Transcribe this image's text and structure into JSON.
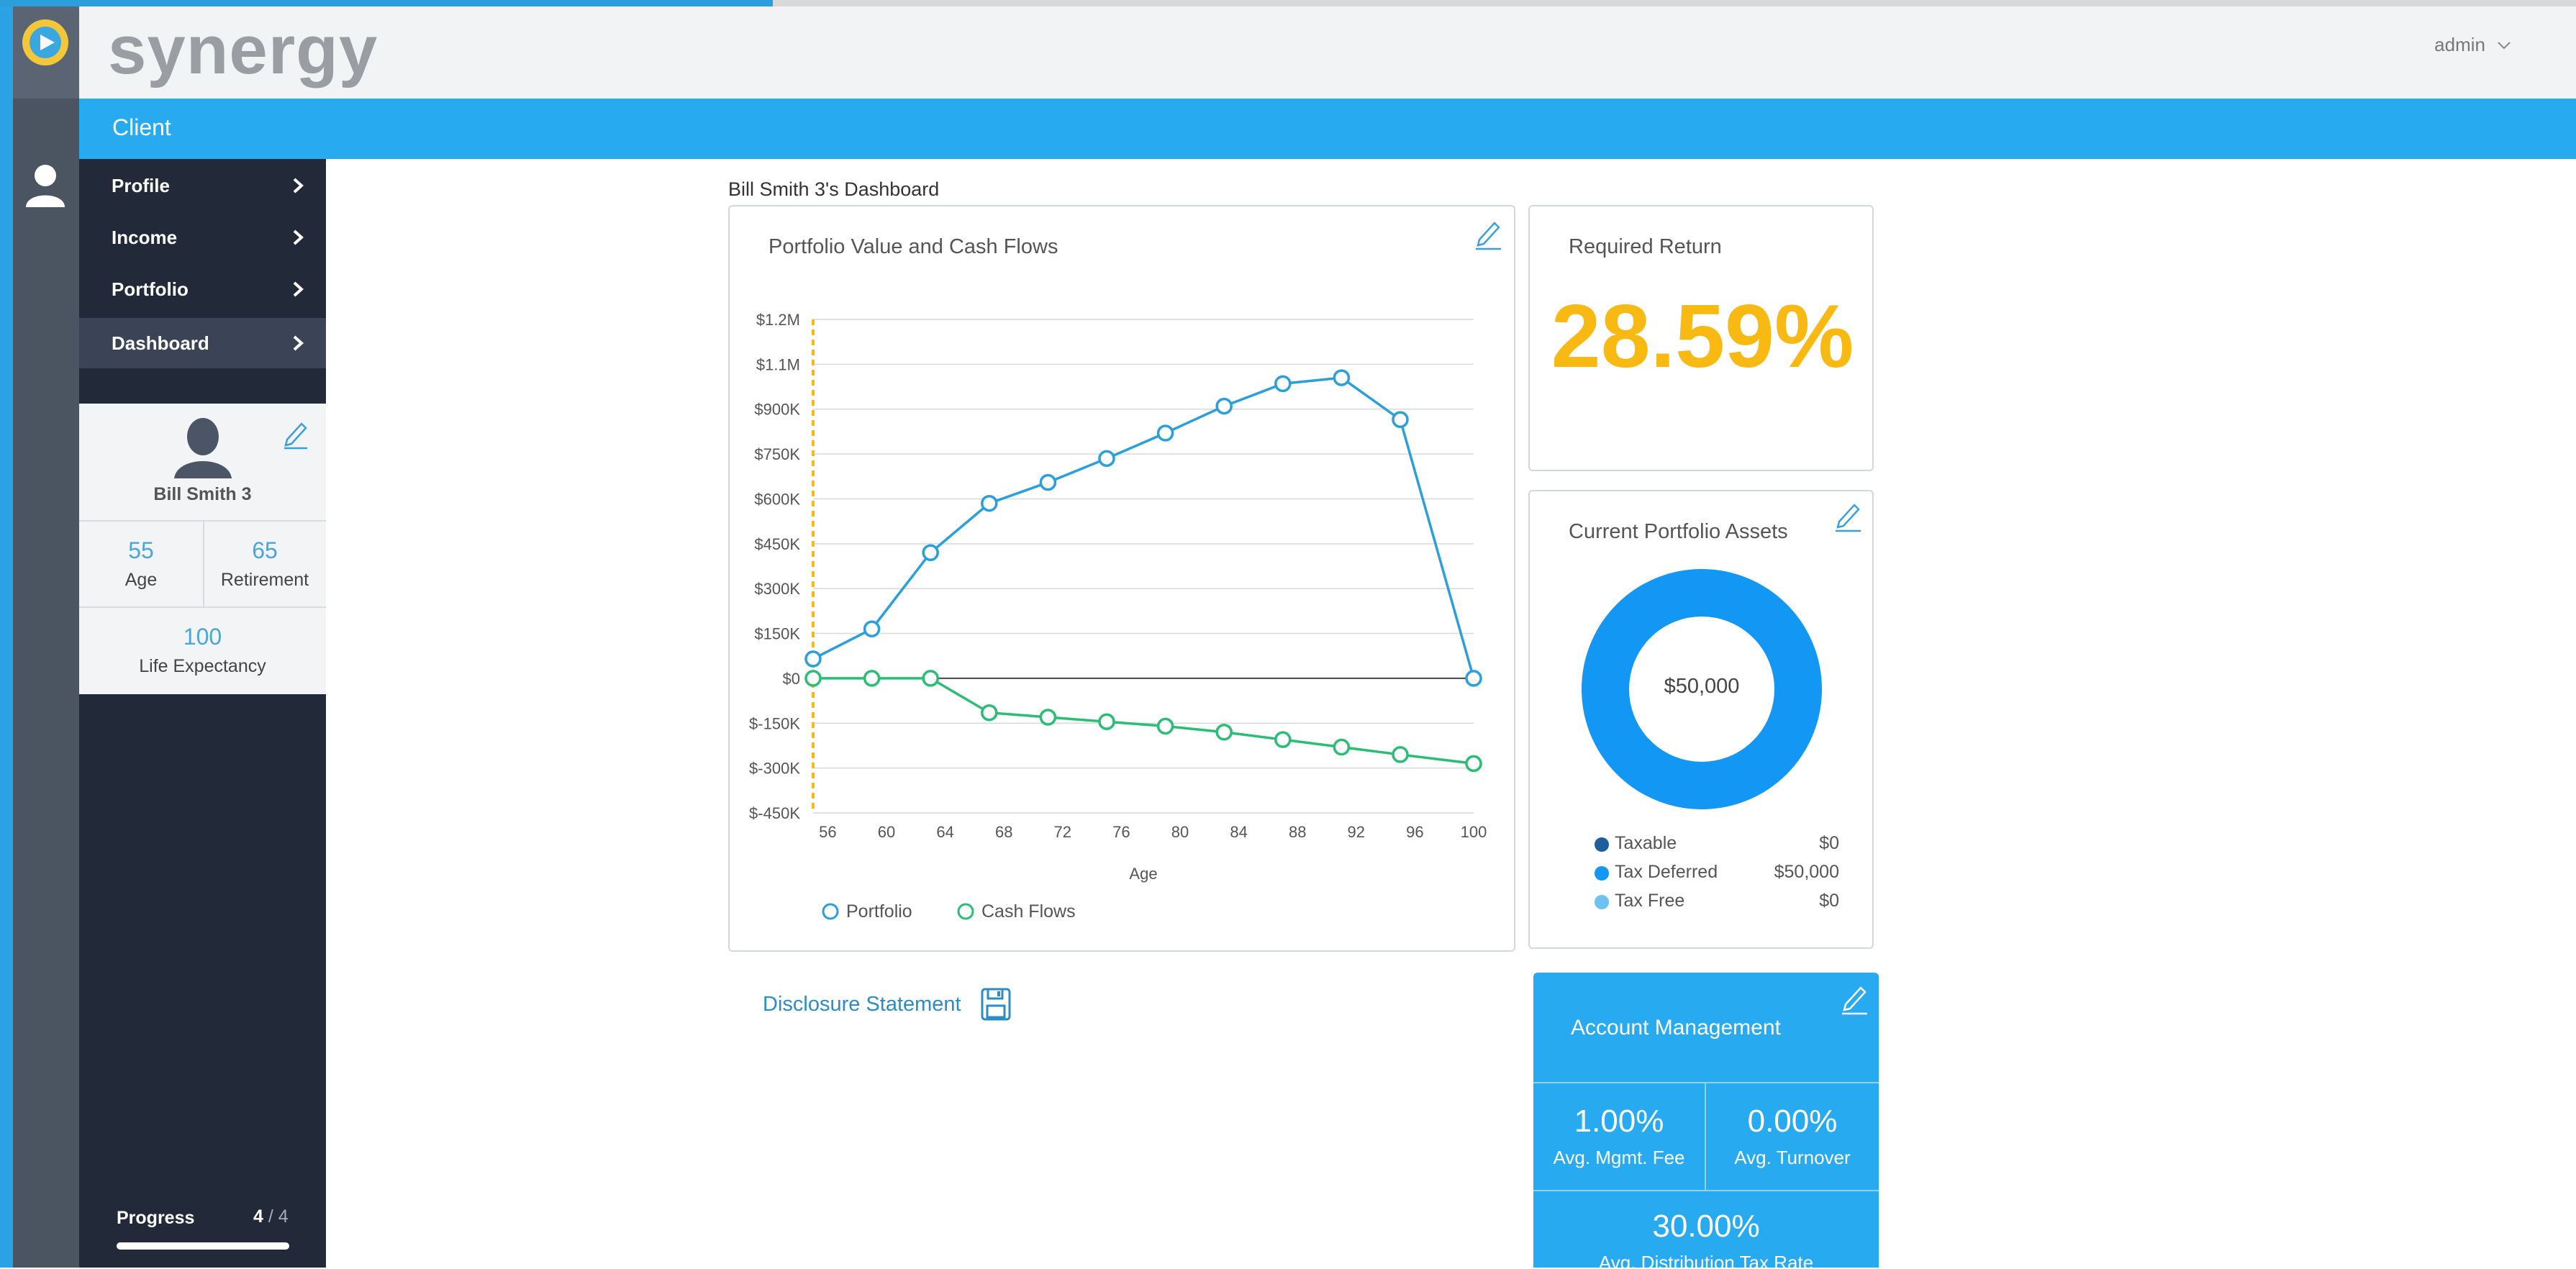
{
  "app": {
    "brand": "synergy",
    "user_menu": "admin",
    "page_progress": 0.3
  },
  "section": {
    "title": "Client"
  },
  "nav": {
    "items": [
      {
        "label": "Profile",
        "active": false
      },
      {
        "label": "Income",
        "active": false
      },
      {
        "label": "Portfolio",
        "active": false
      },
      {
        "label": "Dashboard",
        "active": true
      }
    ]
  },
  "profile": {
    "name": "Bill Smith 3",
    "age": "55",
    "age_label": "Age",
    "retirement": "65",
    "retirement_label": "Retirement",
    "life_expectancy": "100",
    "life_expectancy_label": "Life Expectancy"
  },
  "progress": {
    "label": "Progress",
    "current": "4",
    "total": "/ 4",
    "fraction": 1.0
  },
  "dashboard": {
    "title": "Bill Smith 3's Dashboard"
  },
  "chart_card": {
    "title": "Portfolio Value and Cash Flows"
  },
  "chart_data": {
    "type": "line",
    "title": "Portfolio Value and Cash Flows",
    "xlabel": "Age",
    "ylabel": "",
    "x_ticks": [
      "56",
      "60",
      "64",
      "68",
      "72",
      "76",
      "80",
      "84",
      "88",
      "92",
      "96",
      "100"
    ],
    "y_ticks": [
      "$1.2M",
      "$1.1M",
      "$900K",
      "$750K",
      "$600K",
      "$450K",
      "$300K",
      "$150K",
      "$0",
      "$-150K",
      "$-300K",
      "$-450K"
    ],
    "y_tick_values": [
      1200000,
      1050000,
      900000,
      750000,
      600000,
      450000,
      300000,
      150000,
      0,
      -150000,
      -300000,
      -450000
    ],
    "xlim": [
      55,
      100
    ],
    "ylim": [
      -450000,
      1200000
    ],
    "retirement_marker": 55,
    "x": [
      55,
      59,
      63,
      67,
      71,
      75,
      79,
      83,
      87,
      91,
      95,
      100
    ],
    "series": [
      {
        "name": "Portfolio",
        "color": "#2a9fdc",
        "values": [
          65000,
          165000,
          420000,
          585000,
          655000,
          735000,
          820000,
          910000,
          985000,
          1005000,
          865000,
          0
        ]
      },
      {
        "name": "Cash Flows",
        "color": "#2bbd73",
        "values": [
          0,
          0,
          0,
          -115000,
          -130000,
          -145000,
          -160000,
          -180000,
          -205000,
          -230000,
          -255000,
          -285000
        ]
      }
    ],
    "legend_position": "bottom-left",
    "grid": true
  },
  "required_return": {
    "title": "Required Return",
    "value": "28.59%"
  },
  "assets": {
    "title": "Current Portfolio Assets",
    "total": "$50,000",
    "legend": [
      {
        "name": "Taxable",
        "value": "$0",
        "color": "#1d5f9c"
      },
      {
        "name": "Tax Deferred",
        "value": "$50,000",
        "color": "#1397f5"
      },
      {
        "name": "Tax Free",
        "value": "$0",
        "color": "#6ec2ef"
      }
    ],
    "donut_color": "#1397f5"
  },
  "disclosure": {
    "label": "Disclosure Statement"
  },
  "account": {
    "title": "Account Management",
    "mgmt_fee": "1.00%",
    "mgmt_fee_label": "Avg. Mgmt. Fee",
    "turnover": "0.00%",
    "turnover_label": "Avg. Turnover",
    "dist_tax": "30.00%",
    "dist_tax_label": "Avg. Distribution Tax Rate"
  }
}
